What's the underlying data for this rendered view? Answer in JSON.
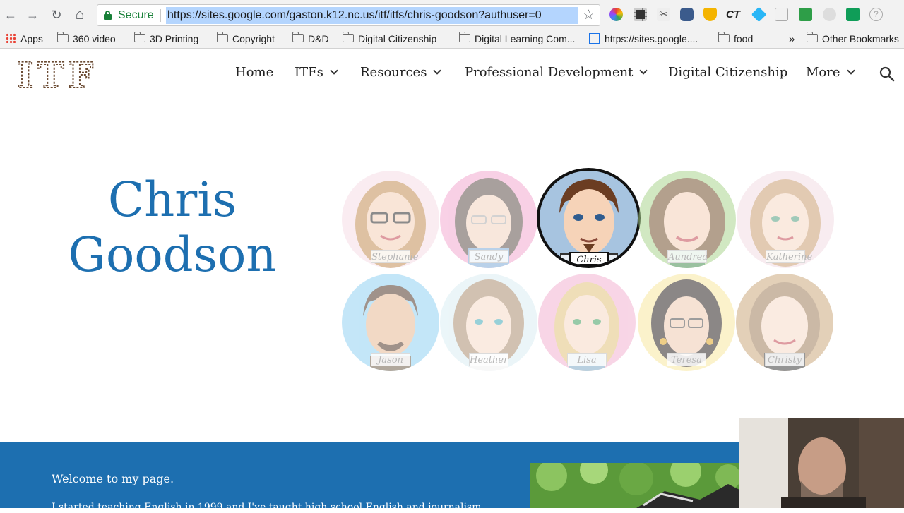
{
  "browser": {
    "back": "←",
    "forward": "→",
    "reload": "↻",
    "home": "⌂",
    "secure_label": "Secure",
    "url": "https://sites.google.com/gaston.k12.nc.us/itf/itfs/chris-goodson?authuser=0",
    "star": "☆",
    "extension_icons": [
      "color-wheel-icon",
      "film-icon",
      "tools-icon",
      "camera-icon",
      "cloud-icon",
      "ct-icon",
      "diamond-icon",
      "page-icon",
      "classroom-icon",
      "ball-icon",
      "cast-icon",
      "help-icon"
    ],
    "ext_ct_label": "CT"
  },
  "bookmarks": {
    "apps": "Apps",
    "items": [
      "360 video",
      "3D Printing",
      "Copyright",
      "D&D",
      "Digital Citizenship",
      "Digital Learning Com...",
      "https://sites.google....",
      "food"
    ],
    "more": "»",
    "other": "Other Bookmarks"
  },
  "site": {
    "logo_text": "ITF",
    "nav": [
      "Home",
      "ITFs",
      "Resources",
      "Professional Development",
      "Digital Citizenship",
      "More"
    ],
    "hero_title_line1": "Chris",
    "hero_title_line2": "Goodson",
    "avatars": [
      "Stephanie",
      "Sandy",
      "Chris",
      "Aundrea",
      "Katherine",
      "Jason",
      "Heather",
      "Lisa",
      "Teresa",
      "Christy"
    ],
    "active_avatar": "Chris",
    "welcome": "Welcome to my page.",
    "intro": "I started teaching English in 1999 and I've taught high school English and journalism..."
  },
  "colors": {
    "accent": "#1d6fb0",
    "secure": "#188038",
    "url_highlight": "#b4d5fe"
  }
}
